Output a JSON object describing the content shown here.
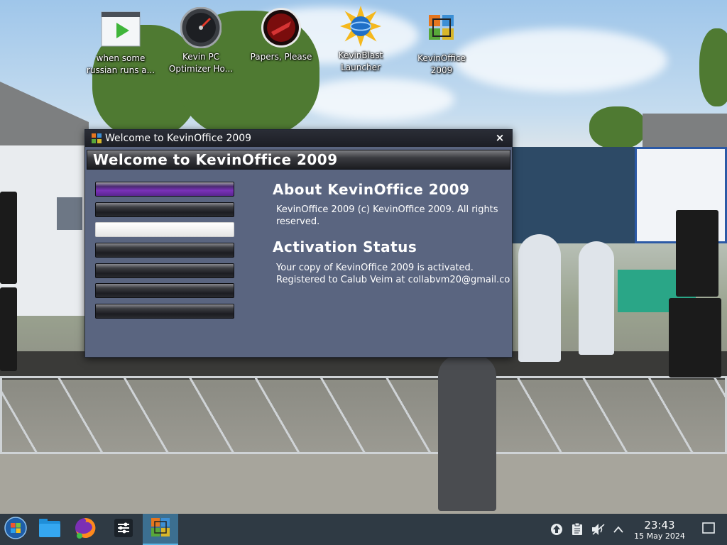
{
  "desktop": {
    "icons": [
      {
        "label": "when some\nrussian runs a...",
        "icon": "video-file-icon"
      },
      {
        "label": "Kevin PC\nOptimizer Ho...",
        "icon": "speedometer-icon"
      },
      {
        "label": "Papers, Please",
        "icon": "papers-please-seal-icon"
      },
      {
        "label": "KevinBlast\nLauncher",
        "icon": "globe-burst-icon"
      },
      {
        "label": "KevinOffice\n2009",
        "icon": "office-logo-icon"
      }
    ]
  },
  "window": {
    "title": "Welcome to KevinOffice 2009",
    "banner": "Welcome to KevinOffice 2009",
    "close_glyph": "×",
    "menu_count": 7,
    "about_heading": "About KevinOffice 2009",
    "about_text": "KevinOffice 2009 (c) KevinOffice 2009. All rights reserved.",
    "activation_heading": "Activation Status",
    "activation_text": "Your copy of KevinOffice 2009 is activated.\nRegistered to Calub Veim at collabvm20@gmail.co"
  },
  "taskbar": {
    "items": [
      "start-menu-icon",
      "file-manager-icon",
      "firefox-icon",
      "settings-sliders-icon",
      "kevinoffice-taskbar-icon"
    ],
    "tray": [
      "update-icon",
      "clipboard-icon",
      "volume-muted-icon",
      "chevron-up-icon"
    ],
    "time": "23:43",
    "date": "15 May 2024"
  },
  "colors": {
    "window_bg": "#5a6580",
    "accent_purple": "#7a32b8",
    "taskbar_bg": "#2f3a44",
    "taskbar_active": "#3c6f90"
  }
}
